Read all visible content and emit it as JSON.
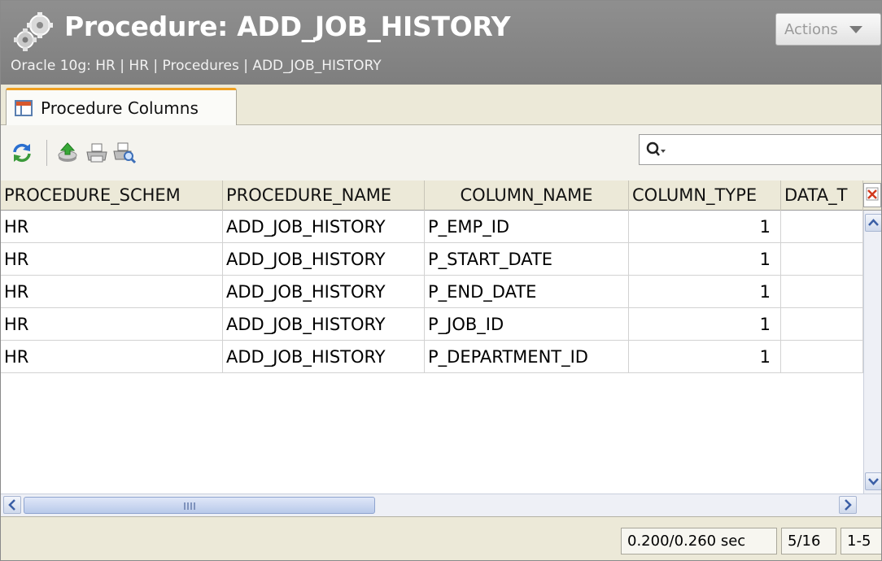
{
  "header": {
    "title": "Procedure: ADD_JOB_HISTORY",
    "breadcrumb": "Oracle 10g: HR | HR | Procedures | ADD_JOB_HISTORY",
    "actions_label": "Actions"
  },
  "tabs": [
    {
      "label": "Procedure Columns",
      "icon": "table-icon",
      "active": true
    }
  ],
  "toolbar": {
    "icons": [
      "refresh-icon",
      "export-icon",
      "print-icon",
      "print-preview-icon"
    ],
    "search_value": ""
  },
  "table": {
    "columns": [
      "PROCEDURE_SCHEM",
      "PROCEDURE_NAME",
      "COLUMN_NAME",
      "COLUMN_TYPE",
      "DATA_T"
    ],
    "rows": [
      [
        "HR",
        "ADD_JOB_HISTORY",
        "P_EMP_ID",
        "1",
        ""
      ],
      [
        "HR",
        "ADD_JOB_HISTORY",
        "P_START_DATE",
        "1",
        ""
      ],
      [
        "HR",
        "ADD_JOB_HISTORY",
        "P_END_DATE",
        "1",
        ""
      ],
      [
        "HR",
        "ADD_JOB_HISTORY",
        "P_JOB_ID",
        "1",
        ""
      ],
      [
        "HR",
        "ADD_JOB_HISTORY",
        "P_DEPARTMENT_ID",
        "1",
        ""
      ]
    ]
  },
  "status": {
    "timing": "0.200/0.260 sec",
    "columns": "5/16",
    "rows": "1-5"
  },
  "colors": {
    "header_bg": "#878787",
    "tab_accent": "#f0a020",
    "panel_bg": "#ece9d8"
  }
}
